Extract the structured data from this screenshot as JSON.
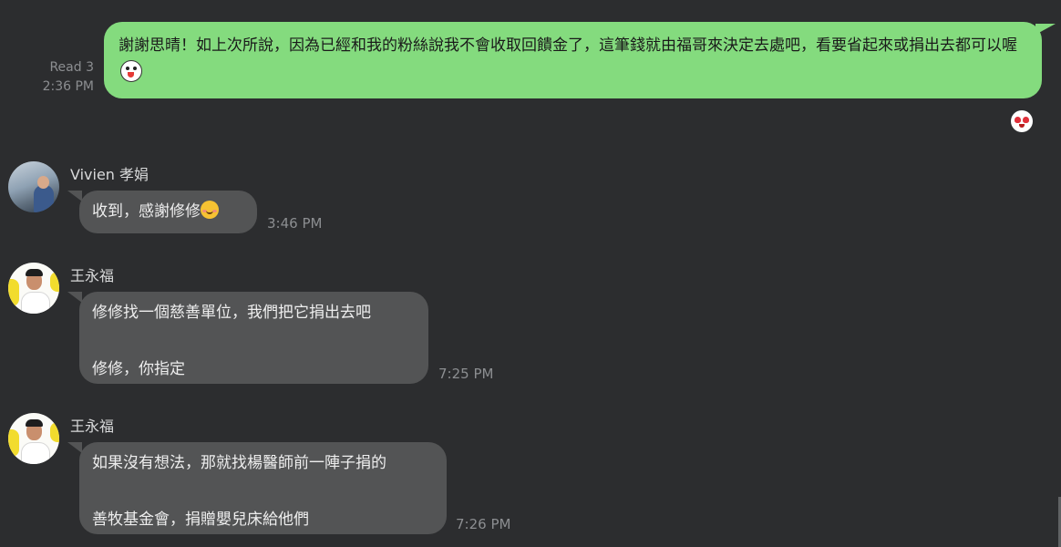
{
  "outgoing": {
    "read_label": "Read 3",
    "time": "2:36 PM",
    "text": "謝謝思晴！如上次所說，因為已經和我的粉絲說我不會收取回饋金了，這筆錢就由福哥來決定去處吧，看要省起來或捐出去都可以喔",
    "sticker_icon": "line-brown-sticker-icon",
    "reaction_icon": "love-eyes-reaction-icon",
    "bubble_color": "#84db7e"
  },
  "messages": [
    {
      "sender": "Vivien 孝娟",
      "avatar": "vivien-avatar",
      "lines": [
        "收到，感謝修修"
      ],
      "emoji": "smiling-face-with-blush-icon",
      "time": "3:46 PM"
    },
    {
      "sender": "王永福",
      "avatar": "wang-avatar",
      "lines": [
        "修修找一個慈善單位，我們把它捐出去吧",
        "修修，你指定"
      ],
      "time": "7:25 PM"
    },
    {
      "sender": "王永福",
      "avatar": "wang-avatar",
      "lines": [
        "如果沒有想法，那就找楊醫師前一陣子捐的",
        "善牧基金會，捐贈嬰兒床給他們"
      ],
      "time": "7:26 PM"
    }
  ],
  "colors": {
    "background": "#2c2d2f",
    "incoming_bubble": "#535455",
    "meta_text": "#8c8e91"
  }
}
